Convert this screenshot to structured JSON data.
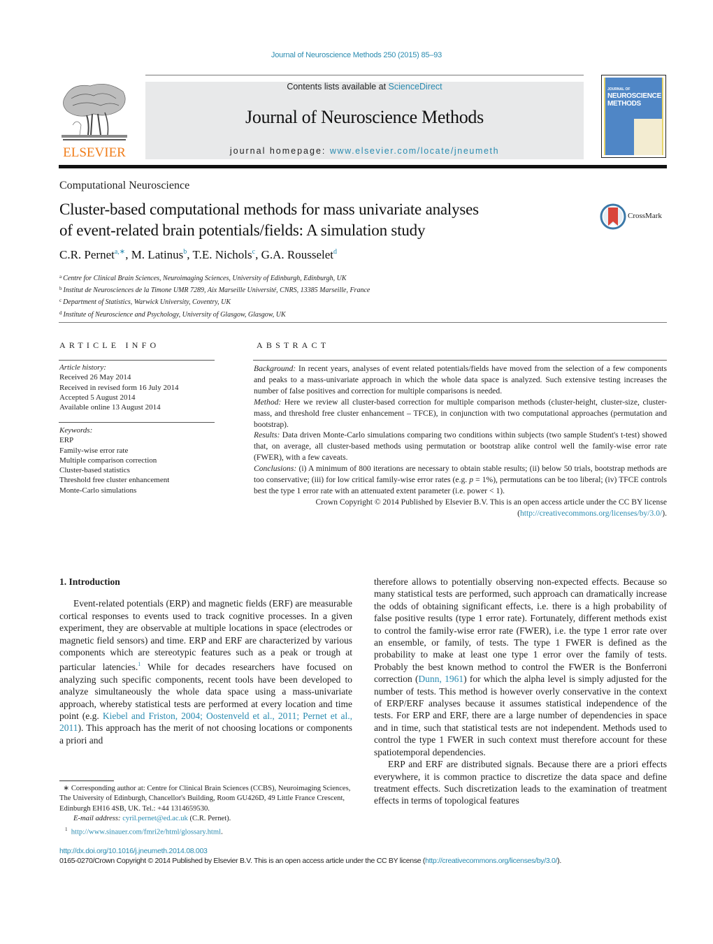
{
  "journal_ref": "Journal of Neuroscience Methods 250 (2015) 85–93",
  "masthead": {
    "contents_prefix": "Contents lists available at ",
    "contents_link": "ScienceDirect",
    "journal_title": "Journal of Neuroscience Methods",
    "homepage_prefix": "journal homepage: ",
    "homepage_link": "www.elsevier.com/locate/jneumeth",
    "publisher_logo_text": "ELSEVIER",
    "cover_small": "JOURNAL OF",
    "cover_title_line1": "NEUROSCIENCE",
    "cover_title_line2": "METHODS"
  },
  "colors": {
    "link": "#2a8bb0",
    "elsevier_orange": "#f07d1a",
    "masthead_bg": "#e8e9ea",
    "cover_blue": "#4f86c6",
    "crossmark_red": "#d9453a"
  },
  "article": {
    "section": "Computational Neuroscience",
    "title_line1": "Cluster-based computational methods for mass univariate analyses",
    "title_line2": "of event-related brain potentials/fields: A simulation study",
    "crossmark_label": "CrossMark",
    "authors": [
      {
        "name": "C.R. Pernet",
        "sup": "a,∗"
      },
      {
        "name": "M. Latinus",
        "sup": "b"
      },
      {
        "name": "T.E. Nichols",
        "sup": "c"
      },
      {
        "name": "G.A. Rousselet",
        "sup": "d"
      }
    ],
    "affiliations": [
      {
        "key": "a",
        "text": "Centre for Clinical Brain Sciences, Neuroimaging Sciences, University of Edinburgh, Edinburgh, UK"
      },
      {
        "key": "b",
        "text": "Institut de Neurosciences de la Timone UMR 7289, Aix Marseille Université, CNRS, 13385 Marseille, France"
      },
      {
        "key": "c",
        "text": "Department of Statistics, Warwick University, Coventry, UK"
      },
      {
        "key": "d",
        "text": "Institute of Neuroscience and Psychology, University of Glasgow, Glasgow, UK"
      }
    ]
  },
  "article_info": {
    "heading": "ARTICLE INFO",
    "history_label": "Article history:",
    "history": [
      "Received 26 May 2014",
      "Received in revised form 16 July 2014",
      "Accepted 5 August 2014",
      "Available online 13 August 2014"
    ],
    "keywords_label": "Keywords:",
    "keywords": [
      "ERP",
      "Family-wise error rate",
      "Multiple comparison correction",
      "Cluster-based statistics",
      "Threshold free cluster enhancement",
      "Monte-Carlo simulations"
    ]
  },
  "abstract": {
    "heading": "ABSTRACT",
    "background_label": "Background:",
    "background": " In recent years, analyses of event related potentials/fields have moved from the selection of a few components and peaks to a mass-univariate approach in which the whole data space is analyzed. Such extensive testing increases the number of false positives and correction for multiple comparisons is needed.",
    "method_label": "Method:",
    "method": " Here we review all cluster-based correction for multiple comparison methods (cluster-height, cluster-size, cluster-mass, and threshold free cluster enhancement – TFCE), in conjunction with two computational approaches (permutation and bootstrap).",
    "results_label": "Results:",
    "results": " Data driven Monte-Carlo simulations comparing two conditions within subjects (two sample Student's t-test) showed that, on average, all cluster-based methods using permutation or bootstrap alike control well the family-wise error rate (FWER), with a few caveats.",
    "conclusions_label": "Conclusions:",
    "conclusions_a": " (i) A minimum of 800 iterations are necessary to obtain stable results; (ii) below 50 trials, bootstrap methods are too conservative; (iii) for low critical family-wise error rates (e.g. ",
    "conclusions_p": "p",
    "conclusions_b": " = 1%), permutations can be too liberal; (iv) TFCE controls best the type 1 error rate with an attenuated extent parameter (i.e. power < 1).",
    "copyright_a": "Crown Copyright © 2014 Published by Elsevier B.V. This is an open access article under the CC BY license (",
    "copyright_link": "http://creativecommons.org/licenses/by/3.0/",
    "copyright_b": ")."
  },
  "body": {
    "intro_heading": "1.  Introduction",
    "left_p1_a": "Event-related potentials (ERP) and magnetic fields (ERF) are measurable cortical responses to events used to track cognitive processes. In a given experiment, they are observable at multiple locations in space (electrodes or magnetic field sensors) and time. ERP and ERF are characterized by various components which are stereotypic features such as a peak or trough at particular latencies.",
    "left_p1_sup": "1",
    "left_p1_b": " While for decades researchers have focused on analyzing such specific components, recent tools have been developed to analyze simultaneously the whole data space using a mass-univariate approach, whereby statistical tests are performed at every location and time point (e.g. ",
    "left_p1_cite": "Kiebel and Friston, 2004; Oostenveld et al., 2011; Pernet et al., 2011",
    "left_p1_c": "). This approach has the merit of not choosing locations or components a priori and",
    "right_p1_a": "therefore allows to potentially observing non-expected effects. Because so many statistical tests are performed, such approach can dramatically increase the odds of obtaining significant effects, i.e. there is a high probability of false positive results (type 1 error rate). Fortunately, different methods exist to control the family-wise error rate (FWER), i.e. the type 1 error rate over an ensemble, or family, of tests. The type 1 FWER is defined as the probability to make at least one type 1 error over the family of tests. Probably the best known method to control the FWER is the Bonferroni correction (",
    "right_p1_cite": "Dunn, 1961",
    "right_p1_b": ") for which the alpha level is simply adjusted for the number of tests. This method is however overly conservative in the context of ERP/ERF analyses because it assumes statistical independence of the tests. For ERP and ERF, there are a large number of dependencies in space and in time, such that statistical tests are not independent. Methods used to control the type 1 FWER in such context must therefore account for these spatiotemporal dependencies.",
    "right_p2": "ERP and ERF are distributed signals. Because there are a priori effects everywhere, it is common practice to discretize the data space and define treatment effects. Such discretization leads to the examination of treatment effects in terms of topological features"
  },
  "footnotes": {
    "corr_mark": "∗",
    "corr_text": " Corresponding author at: Centre for Clinical Brain Sciences (CCBS), Neuroimaging Sciences, The University of Edinburgh, Chancellor's Building, Room GU426D, 49 Little France Crescent, Edinburgh EH16 4SB, UK. Tel.: +44 1314659530.",
    "email_label": "E-mail address:",
    "email": "cyril.pernet@ed.ac.uk",
    "email_suffix": " (C.R. Pernet).",
    "fn1_mark": "1",
    "fn1_link": "http://www.sinauer.com/fmri2e/html/glossary.html",
    "fn1_suffix": "."
  },
  "footer": {
    "doi": "http://dx.doi.org/10.1016/j.jneumeth.2014.08.003",
    "issn_a": "0165-0270/Crown Copyright © 2014 Published by Elsevier B.V. This is an open access article under the CC BY license (",
    "issn_link": "http://creativecommons.org/licenses/by/3.0/",
    "issn_b": ")."
  }
}
